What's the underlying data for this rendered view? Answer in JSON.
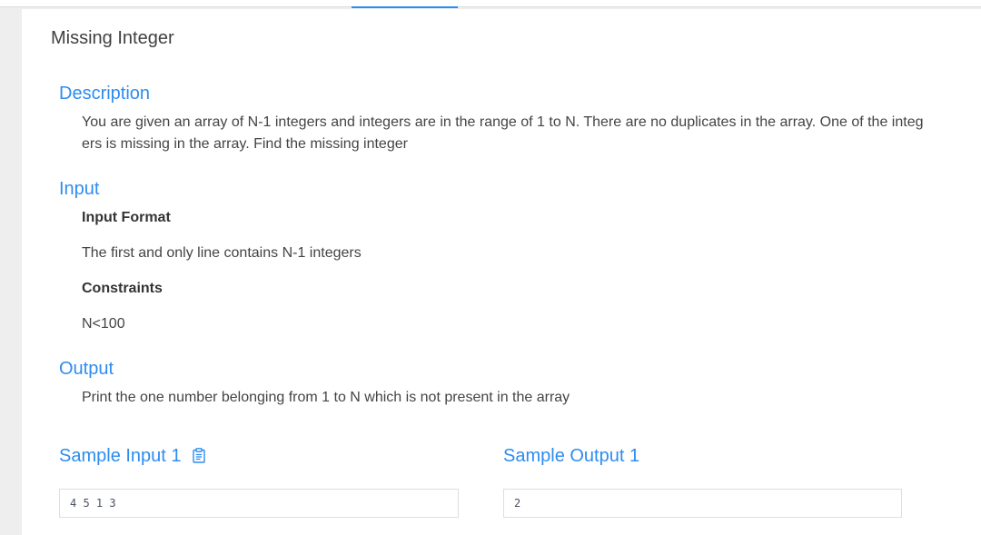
{
  "problem": {
    "title": "Missing Integer"
  },
  "sections": {
    "description": {
      "title": "Description",
      "text": "You are given an array of N-1 integers and integers are in the range of 1 to N. There are no duplicates in the array. One of the integers is missing in the array. Find the missing integer"
    },
    "input": {
      "title": "Input",
      "format_label": "Input Format",
      "format_text": "The first and only line contains N-1 integers",
      "constraints_label": "Constraints",
      "constraints_text": "N<100"
    },
    "output": {
      "title": "Output",
      "text": "Print the one number belonging from 1 to N which is not present in the array"
    }
  },
  "samples": {
    "input_title": "Sample Input 1",
    "input_value": "4 5 1 3",
    "output_title": "Sample Output 1",
    "output_value": "2",
    "copy_icon": "clipboard-icon"
  },
  "colors": {
    "accent": "#2d8cf0",
    "title_text": "#404040",
    "body_text": "#444444",
    "background": "#eeeeee"
  }
}
